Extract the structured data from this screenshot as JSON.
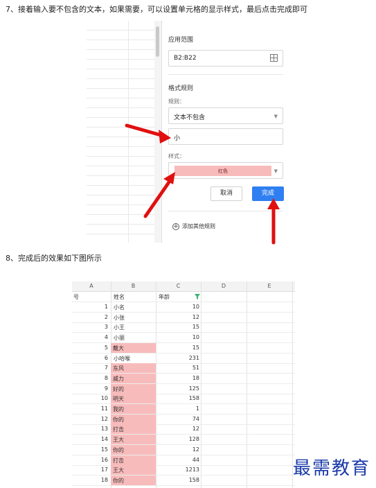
{
  "steps": {
    "step7": "7、接着输入要不包含的文本，如果需要，可以设置单元格的显示样式，最后点击完成即可",
    "step8": "8、完成后的效果如下图所示"
  },
  "panel": {
    "range_label": "应用范围",
    "range_value": "B2:B22",
    "rules_label": "格式规则",
    "rule_sub": "规则：",
    "rule_value": "文本不包含",
    "text_value": "小",
    "style_sub": "样式：",
    "style_value": "红色",
    "cancel": "取消",
    "done": "完成",
    "add_rule": "添加其他规则"
  },
  "sheet": {
    "columns": [
      "A",
      "B",
      "C",
      "D",
      "E"
    ],
    "header_row": {
      "a": "号",
      "b": "姓名",
      "c": "年龄"
    },
    "rows": [
      {
        "a": "1",
        "b": "小名",
        "c": "10",
        "hl": false
      },
      {
        "a": "2",
        "b": "小张",
        "c": "12",
        "hl": false
      },
      {
        "a": "3",
        "b": "小王",
        "c": "15",
        "hl": false
      },
      {
        "a": "4",
        "b": "小丽",
        "c": "10",
        "hl": false
      },
      {
        "a": "5",
        "b": "戴大",
        "c": "15",
        "hl": true
      },
      {
        "a": "6",
        "b": "小哈喉",
        "c": "231",
        "hl": false
      },
      {
        "a": "7",
        "b": "东风",
        "c": "51",
        "hl": true
      },
      {
        "a": "8",
        "b": "威力",
        "c": "18",
        "hl": true
      },
      {
        "a": "9",
        "b": "好的",
        "c": "125",
        "hl": true
      },
      {
        "a": "10",
        "b": "明天",
        "c": "158",
        "hl": true
      },
      {
        "a": "11",
        "b": "我的",
        "c": "1",
        "hl": true
      },
      {
        "a": "12",
        "b": "你的",
        "c": "74",
        "hl": true
      },
      {
        "a": "13",
        "b": "打击",
        "c": "12",
        "hl": true
      },
      {
        "a": "14",
        "b": "王大",
        "c": "128",
        "hl": true
      },
      {
        "a": "15",
        "b": "你的",
        "c": "12",
        "hl": true
      },
      {
        "a": "16",
        "b": "打击",
        "c": "44",
        "hl": true
      },
      {
        "a": "17",
        "b": "王大",
        "c": "1213",
        "hl": true
      },
      {
        "a": "18",
        "b": "你的",
        "c": "158",
        "hl": true
      }
    ]
  },
  "watermark": "最需教育",
  "colors": {
    "highlight": "#f8bbbb",
    "primary_button": "#2f7ff2",
    "arrow": "#e01010",
    "watermark": "#1a3aa8",
    "filter_icon": "#3cb371"
  },
  "icons": [
    "grid-icon",
    "chevron-down-icon",
    "add-circle-icon",
    "filter-icon"
  ]
}
